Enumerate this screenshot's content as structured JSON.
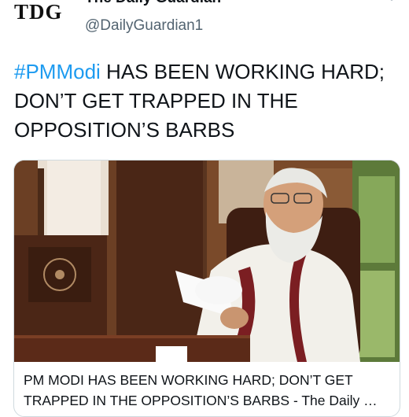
{
  "account": {
    "logo_text": "TDG",
    "display_name": "The Daily Guardian",
    "handle": "@DailyGuardian1"
  },
  "tweet": {
    "hashtag": "#PMModi",
    "text": " HAS BEEN WORKING HARD; DON’T GET TRAPPED IN THE OPPOSITION’S BARBS"
  },
  "card": {
    "title_line1": "PM MODI HAS BEEN WORKING HARD; DON’T GET",
    "title_line2": "TRAPPED IN THE OPPOSITION’S BARBS - The Daily …"
  },
  "icons": {
    "more": "more-vertical-icon"
  }
}
